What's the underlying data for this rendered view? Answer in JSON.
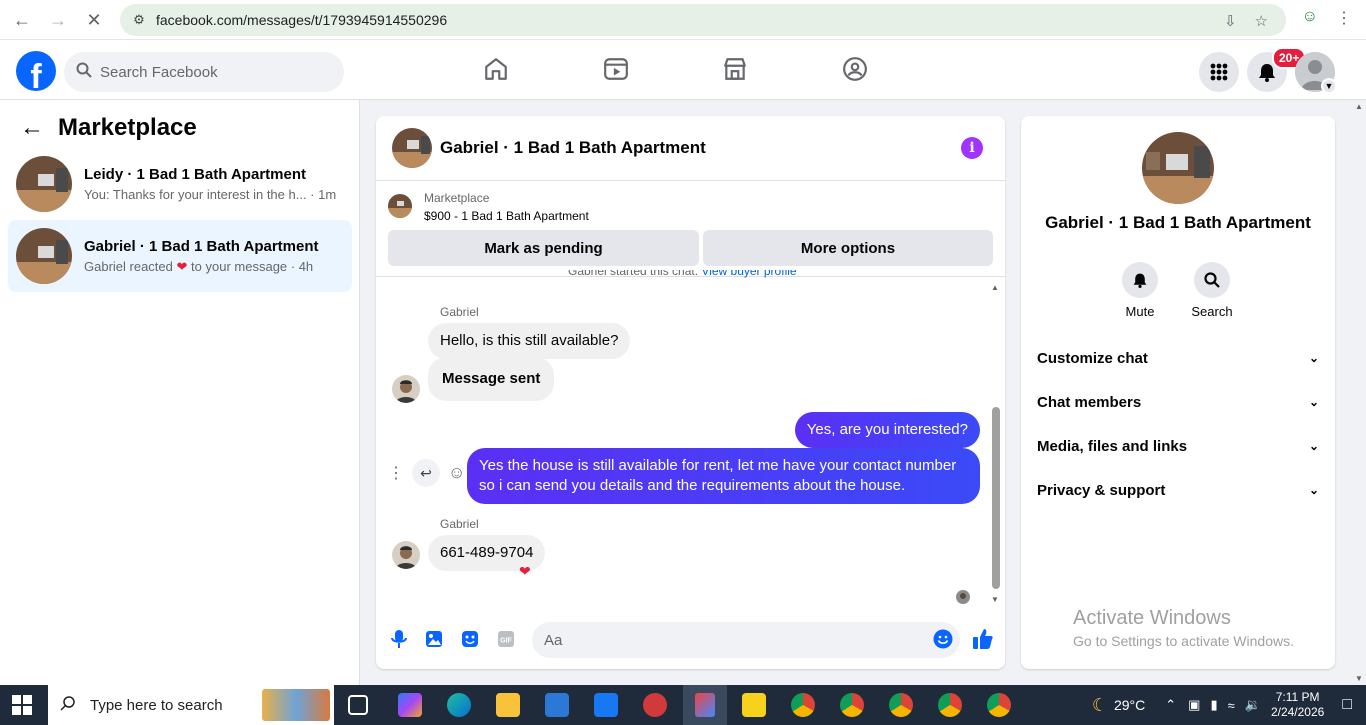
{
  "browser": {
    "url": "facebook.com/messages/t/1793945914550296"
  },
  "header": {
    "search_placeholder": "Search Facebook",
    "notification_count": "20+",
    "brand_color": "#0866ff"
  },
  "sidebar": {
    "title": "Marketplace",
    "conversations": [
      {
        "name": "Leidy · 1 Bad 1 Bath Apartment",
        "preview": "You: Thanks for your interest in the h... · 1m",
        "active": false
      },
      {
        "name": "Gabriel · 1 Bad 1 Bath Apartment",
        "preview_before": "Gabriel reacted",
        "preview_after": "to your message · 4h",
        "active": true
      }
    ]
  },
  "chat": {
    "title": "Gabriel · 1 Bad 1 Bath Apartment",
    "marketplace_label": "Marketplace",
    "listing": "$900 - 1 Bad 1 Bath Apartment",
    "mark_pending": "Mark as pending",
    "more_options": "More options",
    "started_text": "Gabriel started this chat.",
    "view_profile": "View buyer profile",
    "messages": [
      {
        "sender": "Gabriel",
        "text": "Hello, is this still available?"
      },
      {
        "text": "Message sent"
      },
      {
        "text": "Yes, are you interested?",
        "outgoing": true
      },
      {
        "text_line1": "Yes the house is still available for rent, let me have your contact number",
        "text_line2": "so i can send you details and the requirements about the house.",
        "outgoing": true
      },
      {
        "sender": "Gabriel",
        "text": "661-489-9704",
        "reaction": "heart"
      }
    ],
    "composer_placeholder": "Aa"
  },
  "right_panel": {
    "name": "Gabriel · 1 Bad 1 Bath Apartment",
    "mute": "Mute",
    "search": "Search",
    "sections": [
      "Customize chat",
      "Chat members",
      "Media, files and links",
      "Privacy & support"
    ]
  },
  "watermark": {
    "line1": "Activate Windows",
    "line2": "Go to Settings to activate Windows."
  },
  "taskbar": {
    "search_text": "Type here to search",
    "weather": "29°C",
    "time": "7:11 PM",
    "date": "2/24/2026"
  }
}
